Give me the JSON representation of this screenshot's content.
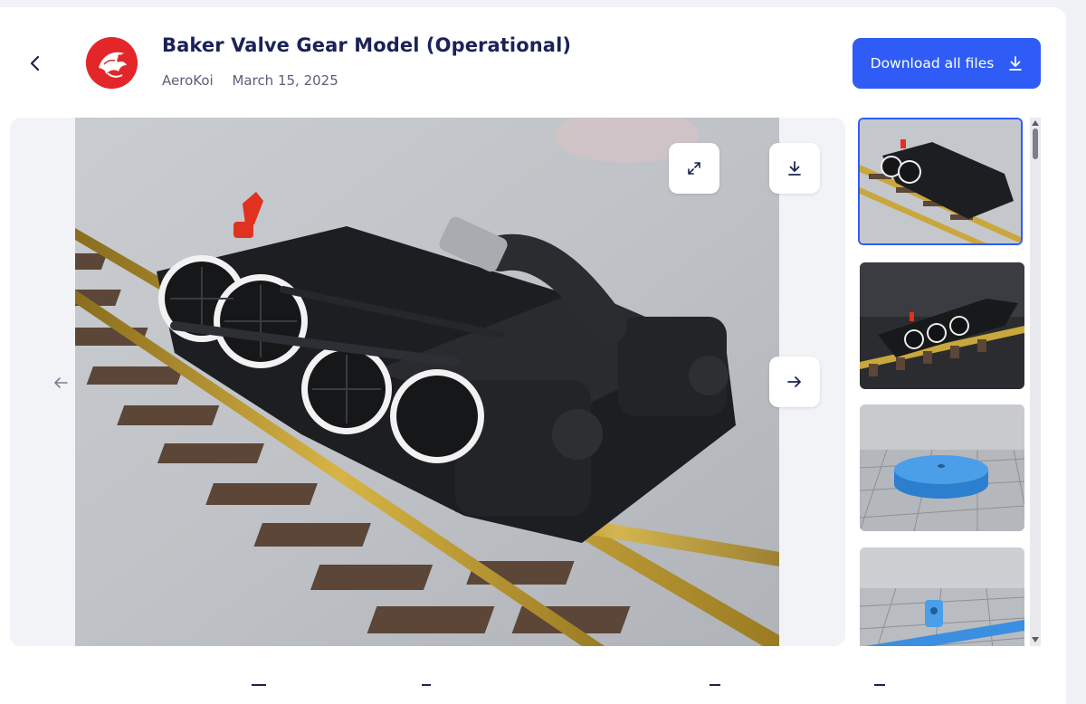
{
  "header": {
    "title": "Baker Valve Gear Model (Operational)",
    "author": "AeroKoi",
    "date": "March 15, 2025",
    "download_all_label": "Download all files"
  },
  "icons": {
    "back": "chevron-left-icon",
    "download": "download-icon",
    "expand": "expand-icon",
    "prev": "arrow-left-icon",
    "next": "arrow-right-icon"
  },
  "colors": {
    "accent": "#2f5cf6",
    "avatar": "#e3262a",
    "title": "#1a2258"
  },
  "gallery": {
    "current_index": 1,
    "thumbnails": [
      {
        "label": "photo-locomotive-chassis-side",
        "selected": true
      },
      {
        "label": "photo-locomotive-chassis-top",
        "selected": false
      },
      {
        "label": "render-blue-disc",
        "selected": false
      },
      {
        "label": "render-blue-bracket",
        "selected": false
      }
    ]
  }
}
